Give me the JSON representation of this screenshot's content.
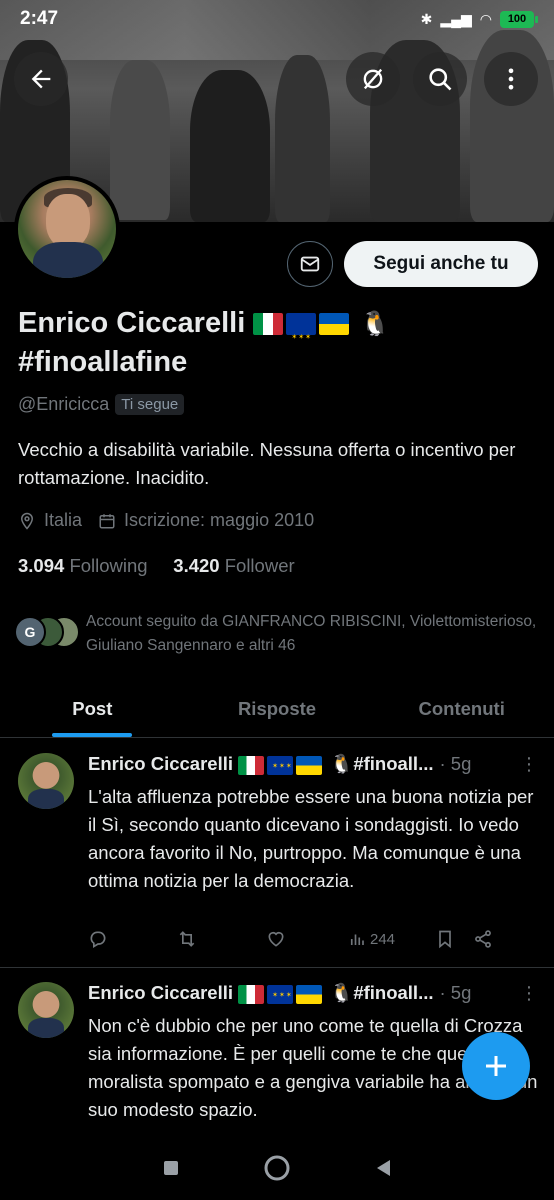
{
  "status": {
    "time": "2:47",
    "battery": "100"
  },
  "header": {
    "back_icon": "arrow-left-icon",
    "icons": [
      "grok-icon",
      "search-icon",
      "more-vertical-icon"
    ]
  },
  "profile": {
    "name_text": "Enrico Ciccarelli",
    "flags": [
      "italy-flag",
      "eu-flag",
      "ukraine-flag"
    ],
    "emoji": "🐧",
    "hashtag": "#finoallafine",
    "handle": "@Enricicca",
    "follows_you": "Ti segue",
    "bio": "Vecchio a disabilità variabile. Nessuna offerta o incentivo per rottamazione. Inacidito.",
    "location": "Italia",
    "joined": "Iscrizione: maggio 2010",
    "following_count": "3.094",
    "following_label": "Following",
    "followers_count": "3.420",
    "followers_label": "Follower",
    "follow_button": "Segui anche tu",
    "followed_by_avatar_letter": "G",
    "followed_by": "Account seguito da GIANFRANCO RIBISCINI, Violettomisterioso, Giuliano Sangennaro e altri 46"
  },
  "tabs": [
    {
      "label": "Post",
      "active": true
    },
    {
      "label": "Risposte",
      "active": false
    },
    {
      "label": "Contenuti",
      "active": false
    }
  ],
  "posts": [
    {
      "author": "Enrico Ciccarelli",
      "author_tail": "#finoall...",
      "time": "· 5g",
      "text": "L'alta affluenza potrebbe essere una buona notizia per il Sì, secondo quanto dicevano i sondaggisti. Io vedo ancora favorito il No, purtroppo. Ma comunque è una ottima notizia per la democrazia.",
      "views": "244"
    },
    {
      "author": "Enrico Ciccarelli",
      "author_tail": "#finoall...",
      "time": "· 5g",
      "text": "Non c'è dubbio che per uno come te quella di Crozza sia informazione. È per quelli come te che questo moralista spompato e a gengiva variabile ha ancora un suo modesto spazio."
    }
  ],
  "colors": {
    "accent": "#1d9bf0",
    "background": "#000000",
    "muted": "#71767b"
  }
}
